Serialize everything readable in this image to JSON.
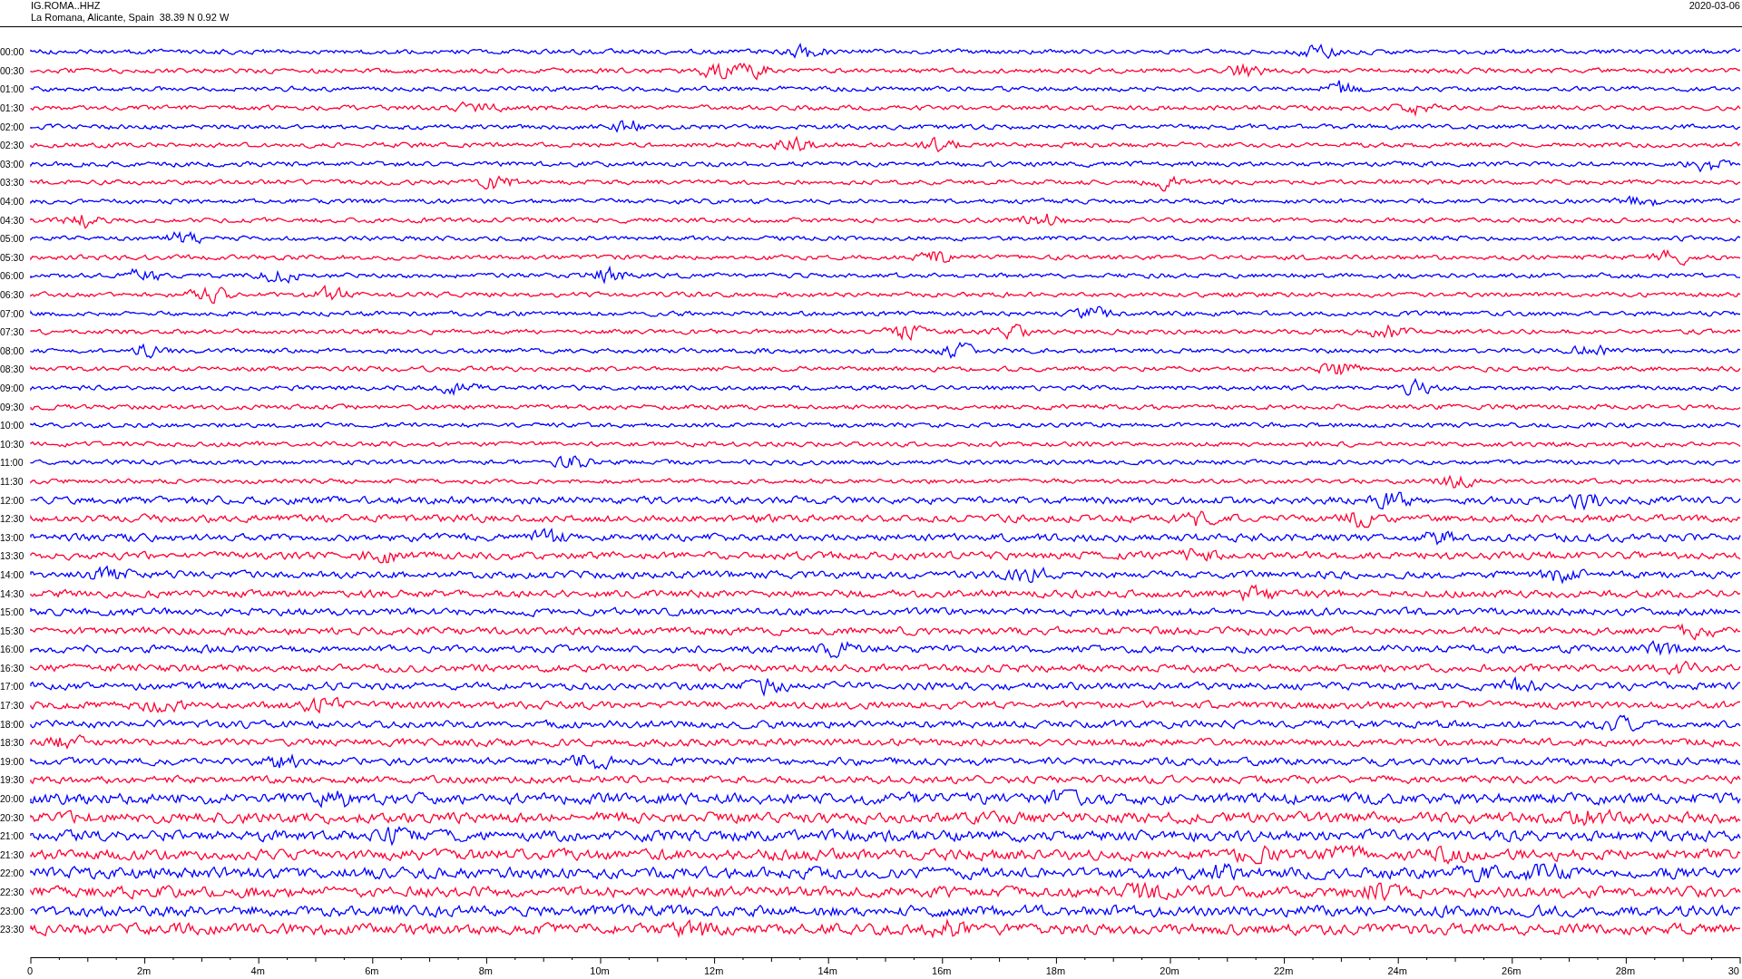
{
  "header": {
    "station": "IG.ROMA..HHZ",
    "location": "La Romana, Alicante, Spain  38.39 N 0.92 W",
    "date": "2020-03-06"
  },
  "rows": [
    {
      "label": "00:00",
      "color": "#0000ff"
    },
    {
      "label": "00:30",
      "color": "#ff0033"
    },
    {
      "label": "01:00",
      "color": "#0000ff"
    },
    {
      "label": "01:30",
      "color": "#ff0033"
    },
    {
      "label": "02:00",
      "color": "#0000ff"
    },
    {
      "label": "02:30",
      "color": "#ff0033"
    },
    {
      "label": "03:00",
      "color": "#0000ff"
    },
    {
      "label": "03:30",
      "color": "#ff0033"
    },
    {
      "label": "04:00",
      "color": "#0000ff"
    },
    {
      "label": "04:30",
      "color": "#ff0033"
    },
    {
      "label": "05:00",
      "color": "#0000ff"
    },
    {
      "label": "05:30",
      "color": "#ff0033"
    },
    {
      "label": "06:00",
      "color": "#0000ff"
    },
    {
      "label": "06:30",
      "color": "#ff0033"
    },
    {
      "label": "07:00",
      "color": "#0000ff"
    },
    {
      "label": "07:30",
      "color": "#ff0033"
    },
    {
      "label": "08:00",
      "color": "#0000ff"
    },
    {
      "label": "08:30",
      "color": "#ff0033"
    },
    {
      "label": "09:00",
      "color": "#0000ff"
    },
    {
      "label": "09:30",
      "color": "#ff0033"
    },
    {
      "label": "10:00",
      "color": "#0000ff"
    },
    {
      "label": "10:30",
      "color": "#ff0033"
    },
    {
      "label": "11:00",
      "color": "#0000ff"
    },
    {
      "label": "11:30",
      "color": "#ff0033"
    },
    {
      "label": "12:00",
      "color": "#0000ff"
    },
    {
      "label": "12:30",
      "color": "#ff0033"
    },
    {
      "label": "13:00",
      "color": "#0000ff"
    },
    {
      "label": "13:30",
      "color": "#ff0033"
    },
    {
      "label": "14:00",
      "color": "#0000ff"
    },
    {
      "label": "14:30",
      "color": "#ff0033"
    },
    {
      "label": "15:00",
      "color": "#0000ff"
    },
    {
      "label": "15:30",
      "color": "#ff0033"
    },
    {
      "label": "16:00",
      "color": "#0000ff"
    },
    {
      "label": "16:30",
      "color": "#ff0033"
    },
    {
      "label": "17:00",
      "color": "#0000ff"
    },
    {
      "label": "17:30",
      "color": "#ff0033"
    },
    {
      "label": "18:00",
      "color": "#0000ff"
    },
    {
      "label": "18:30",
      "color": "#ff0033"
    },
    {
      "label": "19:00",
      "color": "#0000ff"
    },
    {
      "label": "19:30",
      "color": "#ff0033"
    },
    {
      "label": "20:00",
      "color": "#0000ff"
    },
    {
      "label": "20:30",
      "color": "#ff0033"
    },
    {
      "label": "21:00",
      "color": "#0000ff"
    },
    {
      "label": "21:30",
      "color": "#ff0033"
    },
    {
      "label": "22:00",
      "color": "#0000ff"
    },
    {
      "label": "22:30",
      "color": "#ff0033"
    },
    {
      "label": "23:00",
      "color": "#0000ff"
    },
    {
      "label": "23:30",
      "color": "#ff0033"
    }
  ],
  "x_axis": {
    "ticks": [
      "0",
      "2m",
      "4m",
      "6m",
      "8m",
      "10m",
      "12m",
      "14m",
      "16m",
      "18m",
      "20m",
      "22m",
      "24m",
      "26m",
      "28m",
      "30"
    ]
  }
}
